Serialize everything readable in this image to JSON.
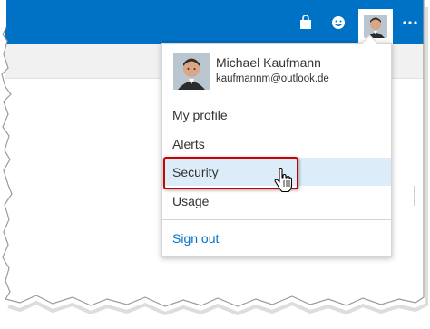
{
  "header": {
    "accent_color": "#0072c6",
    "icons": [
      "shopping-bag-icon",
      "smiley-icon",
      "avatar",
      "more-icon"
    ]
  },
  "user_menu": {
    "name": "Michael Kaufmann",
    "email": "kaufmannm@outlook.de",
    "items": [
      {
        "label": "My profile"
      },
      {
        "label": "Alerts"
      },
      {
        "label": "Security"
      },
      {
        "label": "Usage"
      }
    ],
    "sign_out_label": "Sign out",
    "hovered_item": "Security"
  },
  "annotation": {
    "highlight_color": "#cc0000"
  }
}
